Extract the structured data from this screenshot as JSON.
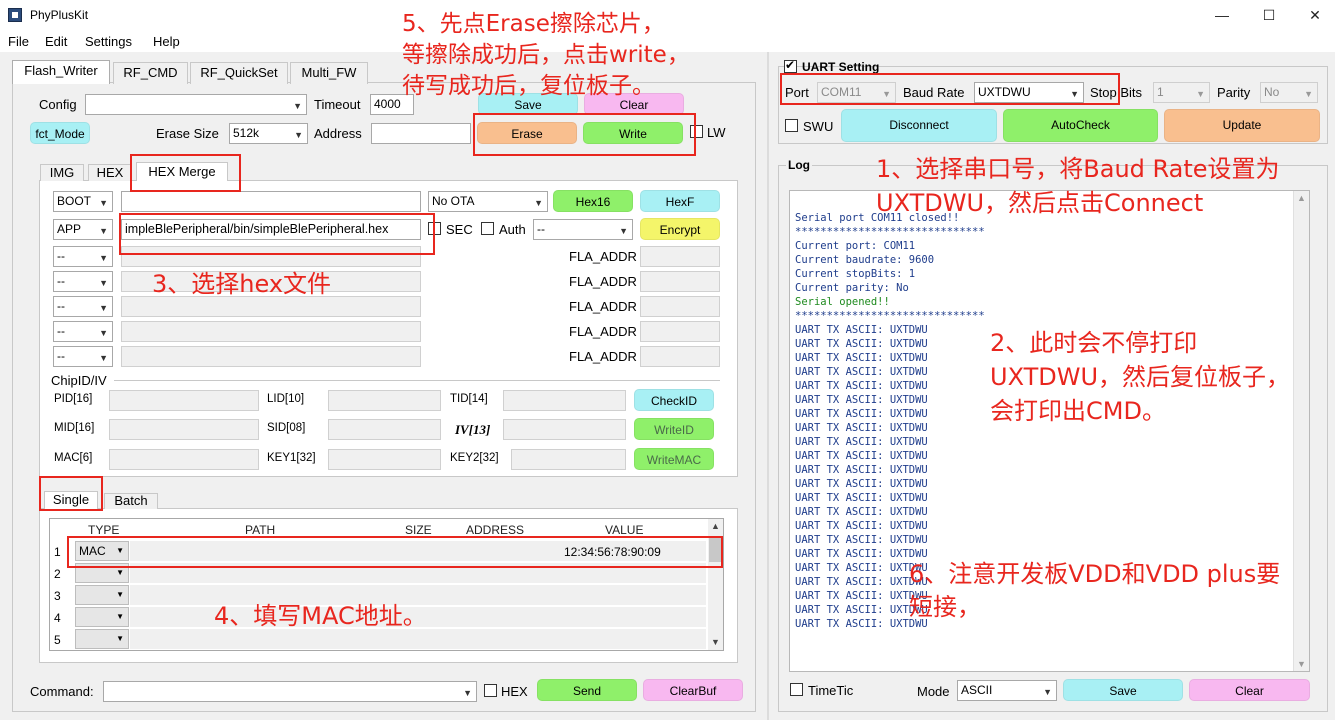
{
  "window": {
    "title": "PhyPlusKit",
    "minimize": "—",
    "maximize": "☐",
    "close": "✕"
  },
  "menu": [
    "File",
    "Edit",
    "Settings",
    "Help"
  ],
  "main_tabs": [
    "Flash_Writer",
    "RF_CMD",
    "RF_QuickSet",
    "Multi_FW"
  ],
  "config": {
    "config_label": "Config",
    "config_value": "",
    "timeout_label": "Timeout",
    "timeout_value": "4000",
    "save_label": "Save",
    "clear_label": "Clear",
    "fct_mode": "fct_Mode",
    "erase_size_label": "Erase Size",
    "erase_size_value": "512k",
    "address_label": "Address",
    "address_value": "",
    "erase_label": "Erase",
    "write_label": "Write",
    "lw_label": "LW"
  },
  "sub_tabs": [
    "IMG",
    "HEX",
    "HEX Merge"
  ],
  "hex_rows": [
    {
      "type": "BOOT",
      "path": "",
      "ota": "No OTA",
      "btn1": "Hex16",
      "btn2": "HexF"
    },
    {
      "type": "APP",
      "path": "impleBlePeripheral/bin/simpleBlePeripheral.hex",
      "sec": "SEC",
      "auth": "Auth",
      "auth_value": "--",
      "btn2": "Encrypt"
    }
  ],
  "extra_rows": [
    {
      "type": "--",
      "fla": "FLA_ADDR"
    },
    {
      "type": "--",
      "fla": "FLA_ADDR"
    },
    {
      "type": "--",
      "fla": "FLA_ADDR"
    },
    {
      "type": "--",
      "fla": "FLA_ADDR"
    },
    {
      "type": "--",
      "fla": "FLA_ADDR"
    }
  ],
  "chip": {
    "title": "ChipID/IV",
    "pid": "PID[16]",
    "lid": "LID[10]",
    "tid": "TID[14]",
    "checkid": "CheckID",
    "mid": "MID[16]",
    "sid": "SID[08]",
    "iv": "IV[13]",
    "writeid": "WriteID",
    "mac": "MAC[6]",
    "key1": "KEY1[32]",
    "key2": "KEY2[32]",
    "writemac": "WriteMAC"
  },
  "bottom_tabs": [
    "Single",
    "Batch"
  ],
  "grid": {
    "headers": [
      "TYPE",
      "PATH",
      "SIZE",
      "ADDRESS",
      "VALUE"
    ],
    "rows": [
      {
        "n": "1",
        "type": "MAC",
        "value": "12:34:56:78:90:09"
      },
      {
        "n": "2",
        "type": "",
        "value": ""
      },
      {
        "n": "3",
        "type": "",
        "value": ""
      },
      {
        "n": "4",
        "type": "",
        "value": ""
      },
      {
        "n": "5",
        "type": "",
        "value": ""
      }
    ]
  },
  "command": {
    "label": "Command:",
    "value": "",
    "hex_label": "HEX",
    "send": "Send",
    "clearbuf": "ClearBuf"
  },
  "uart": {
    "title": "UART Setting",
    "port_label": "Port",
    "port_value": "COM11",
    "baud_label": "Baud Rate",
    "baud_value": "UXTDWU",
    "stop_label": "Stop Bits",
    "stop_value": "1",
    "parity_label": "Parity",
    "parity_value": "No",
    "swu_label": "SWU",
    "disconnect": "Disconnect",
    "autocheck": "AutoCheck",
    "update": "Update"
  },
  "log": {
    "title": "Log",
    "lines": [
      {
        "t": "Serial port COM11 closed!!",
        "c": "blue"
      },
      {
        "t": "******************************",
        "c": "blue"
      },
      {
        "t": "Current port: COM11",
        "c": "blue"
      },
      {
        "t": "Current baudrate: 9600",
        "c": "blue"
      },
      {
        "t": "Current stopBits: 1",
        "c": "blue"
      },
      {
        "t": "Current parity: No",
        "c": "blue"
      },
      {
        "t": "Serial opened!!",
        "c": "green"
      },
      {
        "t": "******************************",
        "c": "blue"
      },
      {
        "t": "UART TX ASCII: UXTDWU",
        "c": "blue"
      },
      {
        "t": "UART TX ASCII: UXTDWU",
        "c": "blue"
      },
      {
        "t": "UART TX ASCII: UXTDWU",
        "c": "blue"
      },
      {
        "t": "UART TX ASCII: UXTDWU",
        "c": "blue"
      },
      {
        "t": "UART TX ASCII: UXTDWU",
        "c": "blue"
      },
      {
        "t": "UART TX ASCII: UXTDWU",
        "c": "blue"
      },
      {
        "t": "UART TX ASCII: UXTDWU",
        "c": "blue"
      },
      {
        "t": "UART TX ASCII: UXTDWU",
        "c": "blue"
      },
      {
        "t": "UART TX ASCII: UXTDWU",
        "c": "blue"
      },
      {
        "t": "UART TX ASCII: UXTDWU",
        "c": "blue"
      },
      {
        "t": "UART TX ASCII: UXTDWU",
        "c": "blue"
      },
      {
        "t": "UART TX ASCII: UXTDWU",
        "c": "blue"
      },
      {
        "t": "UART TX ASCII: UXTDWU",
        "c": "blue"
      },
      {
        "t": "UART TX ASCII: UXTDWU",
        "c": "blue"
      },
      {
        "t": "UART TX ASCII: UXTDWU",
        "c": "blue"
      },
      {
        "t": "UART TX ASCII: UXTDWU",
        "c": "blue"
      },
      {
        "t": "UART TX ASCII: UXTDWU",
        "c": "blue"
      },
      {
        "t": "UART TX ASCII: UXTDWU",
        "c": "blue"
      },
      {
        "t": "UART TX ASCII: UXTDWU",
        "c": "blue"
      },
      {
        "t": "UART TX ASCII: UXTDWU",
        "c": "blue"
      },
      {
        "t": "UART TX ASCII: UXTDWU",
        "c": "blue"
      },
      {
        "t": "UART TX ASCII: UXTDWU",
        "c": "blue"
      }
    ]
  },
  "log_bottom": {
    "timetic": "TimeTic",
    "mode_label": "Mode",
    "mode_value": "ASCII",
    "save": "Save",
    "clear": "Clear"
  },
  "annotations": {
    "a5_l1": "5、先点Erase擦除芯片，",
    "a5_l2": "等擦除成功后，点击write，",
    "a5_l3": "待写成功后，复位板子。",
    "a1_l1": "1、选择串口号，将Baud Rate设置为",
    "a1_l2": "UXTDWU，然后点击Connect",
    "a2_l1": "2、此时会不停打印",
    "a2_l2": "UXTDWU，然后复位板子，",
    "a2_l3": "会打印出CMD。",
    "a3": "3、选择hex文件",
    "a4": "4、填写MAC地址。",
    "a6_l1": "6、注意开发板VDD和VDD plus要",
    "a6_l2": "短接，"
  },
  "colors": {
    "cyan": "#a8f0f4",
    "green": "#8ff06a",
    "orange": "#f9bf8f",
    "pink": "#f8b8f0",
    "yellow": "#f4f56a",
    "red_anno": "#e8261e"
  }
}
